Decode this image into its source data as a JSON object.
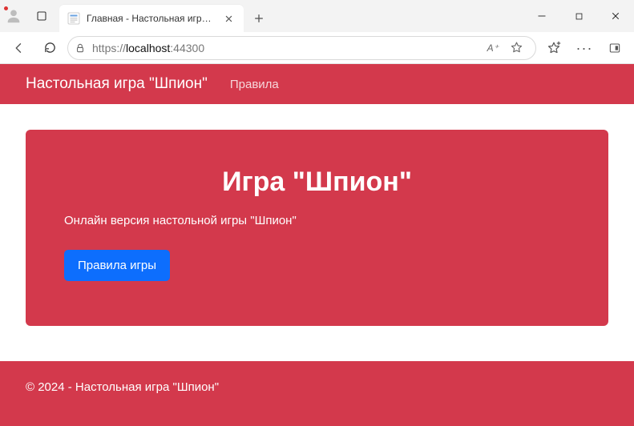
{
  "browser": {
    "tab_title": "Главная - Настольная игра \"Шпион\"",
    "url_scheme": "https://",
    "url_host": "localhost",
    "url_port": ":44300",
    "reader_label": "A⁺"
  },
  "navbar": {
    "brand": "Настольная игра \"Шпион\"",
    "rules_link": "Правила"
  },
  "jumbo": {
    "heading": "Игра \"Шпион\"",
    "subheading": "Онлайн версия настольной игры \"Шпион\"",
    "button": "Правила игры"
  },
  "footer": {
    "text": "© 2024 - Настольная игра \"Шпион\""
  }
}
